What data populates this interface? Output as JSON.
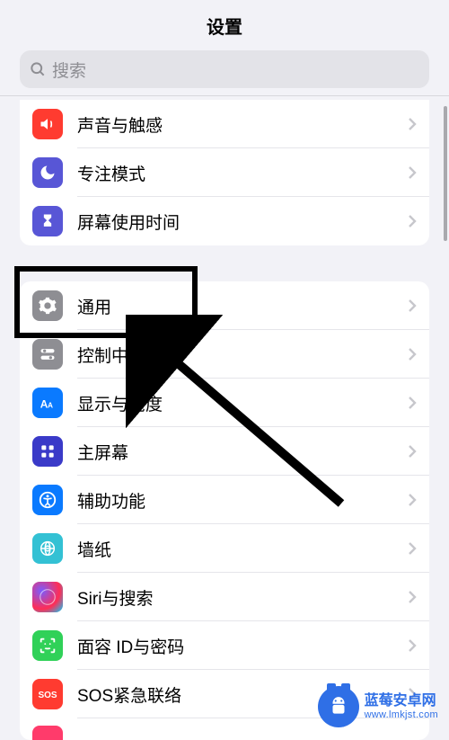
{
  "header": {
    "title": "设置"
  },
  "search": {
    "placeholder": "搜索"
  },
  "group1": [
    {
      "label": "声音与触感",
      "icon": "sound-icon",
      "color": "#ff3b30"
    },
    {
      "label": "专注模式",
      "icon": "moon-icon",
      "color": "#5856d6"
    },
    {
      "label": "屏幕使用时间",
      "icon": "hourglass-icon",
      "color": "#5856d6"
    }
  ],
  "group2": [
    {
      "label": "通用",
      "icon": "gear-icon",
      "color": "#8e8e93"
    },
    {
      "label": "控制中心",
      "icon": "switches-icon",
      "color": "#8e8e93"
    },
    {
      "label": "显示与亮度",
      "icon": "text-size-icon",
      "color": "#0a7aff"
    },
    {
      "label": "主屏幕",
      "icon": "home-grid-icon",
      "color": "#3a3ac8"
    },
    {
      "label": "辅助功能",
      "icon": "accessibility-icon",
      "color": "#0a7aff"
    },
    {
      "label": "墙纸",
      "icon": "wallpaper-icon",
      "color": "#33c1d4"
    },
    {
      "label": "Siri与搜索",
      "icon": "siri-icon",
      "color": "#1c1c1e"
    },
    {
      "label": "面容 ID与密码",
      "icon": "faceid-icon",
      "color": "#30d158"
    },
    {
      "label": "SOS紧急联络",
      "icon": "sos-icon",
      "color": "#ff3b30"
    }
  ],
  "watermark": {
    "line1": "蓝莓安卓网",
    "line2": "www.lmkjst.com"
  }
}
